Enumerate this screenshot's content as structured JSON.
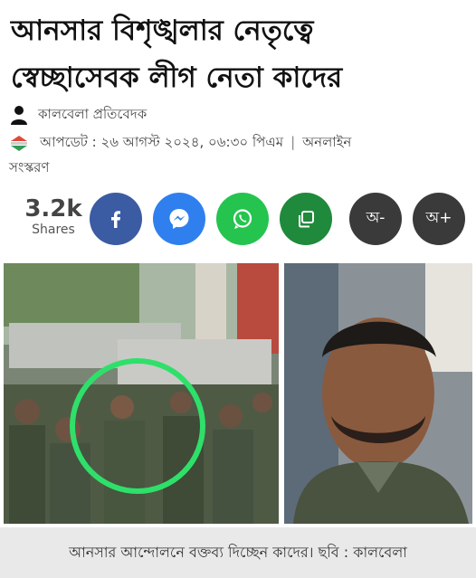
{
  "article": {
    "headline_line1": "আনসার বিশৃঙ্খলার নেতৃত্বে",
    "headline_line2": "স্বেচ্ছাসেবক লীগ নেতা কাদের",
    "author": "কালবেলা প্রতিবেদক",
    "updated": "আপডেট : ২৬ আগস্ট ২০২৪, ০৬:৩০ পিএম",
    "separator": "|",
    "edition_part1": "অনলাইন",
    "edition_part2": "সংস্করণ",
    "caption": "আনসার আন্দোলনে বক্তব্য দিচ্ছেন কাদের। ছবি : কালবেলা"
  },
  "share": {
    "count": "3.2k",
    "label": "Shares",
    "buttons": [
      {
        "icon": "facebook-icon",
        "color": "#3b5ba3"
      },
      {
        "icon": "messenger-icon",
        "color": "#2f80ee"
      },
      {
        "icon": "whatsapp-icon",
        "color": "#25c44f"
      },
      {
        "icon": "copy-icon",
        "color": "#1f8a3b"
      }
    ],
    "font_decrease": "অ-",
    "font_increase": "অ+"
  },
  "colors": {
    "highlight_circle": "#2ee06a",
    "font_button_bg": "#3a3a3a"
  }
}
